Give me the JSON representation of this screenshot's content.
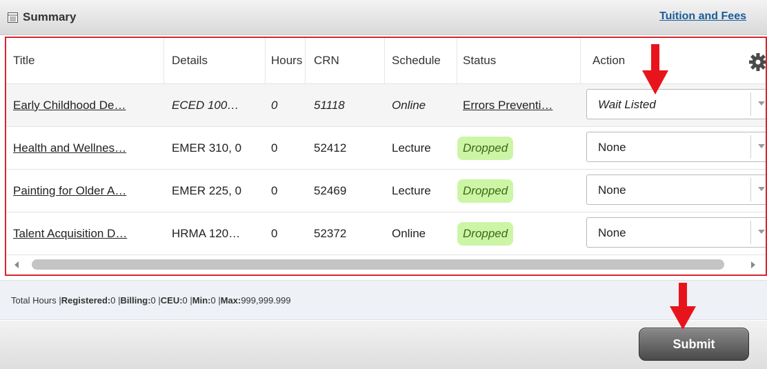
{
  "header": {
    "title": "Summary",
    "fees_link": "Tuition and Fees"
  },
  "table": {
    "columns": {
      "title": "Title",
      "details": "Details",
      "hours": "Hours",
      "crn": "CRN",
      "schedule": "Schedule",
      "status": "Status",
      "action": "Action"
    },
    "rows": [
      {
        "title": "Early Childhood De…",
        "details": "ECED 100…",
        "hours": "0",
        "crn": "51118",
        "schedule": "Online",
        "status": "Errors Preventi…",
        "action": "Wait Listed"
      },
      {
        "title": "Health and Wellnes…",
        "details": "EMER 310, 0",
        "hours": "0",
        "crn": "52412",
        "schedule": "Lecture",
        "status": "Dropped",
        "action": "None"
      },
      {
        "title": "Painting for Older A…",
        "details": "EMER 225, 0",
        "hours": "0",
        "crn": "52469",
        "schedule": "Lecture",
        "status": "Dropped",
        "action": "None"
      },
      {
        "title": "Talent Acquisition D…",
        "details": "HRMA 120…",
        "hours": "0",
        "crn": "52372",
        "schedule": "Online",
        "status": "Dropped",
        "action": "None"
      }
    ]
  },
  "totals": {
    "lead": "Total Hours | ",
    "registered_label": "Registered:",
    "registered_value": " 0 | ",
    "billing_label": "Billing:",
    "billing_value": " 0 | ",
    "ceu_label": "CEU:",
    "ceu_value": " 0 | ",
    "min_label": "Min:",
    "min_value": " 0 | ",
    "max_label": "Max:",
    "max_value": " 999,999.999"
  },
  "footer": {
    "submit_label": "Submit"
  },
  "colors": {
    "grid_border": "#d9232d",
    "annotation_arrow": "#e8141c",
    "dropped_badge": "#ccf5a6",
    "link": "#1a5c9c"
  },
  "icons": {
    "header": "summary-table-icon",
    "grid": "gear-icon"
  }
}
